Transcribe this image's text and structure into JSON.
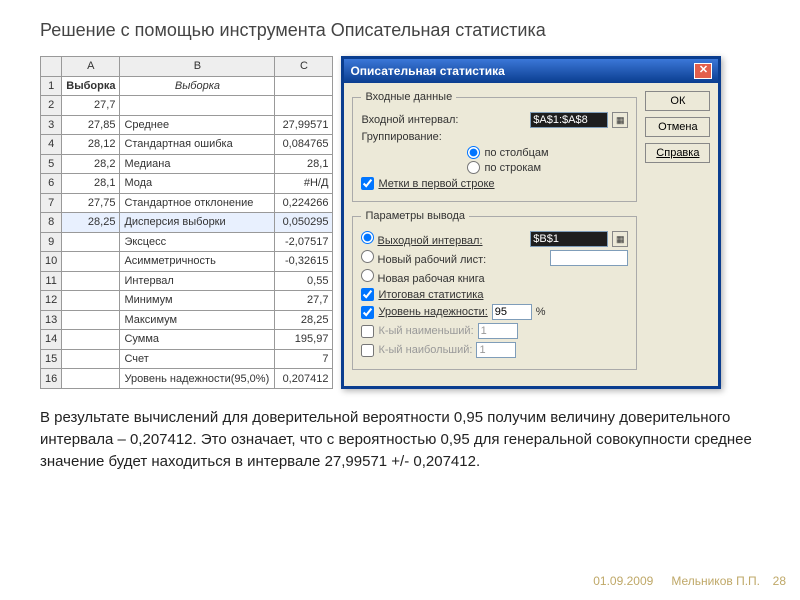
{
  "title": "Решение с помощью инструмента Описательная статистика",
  "spreadsheet": {
    "cols": [
      "A",
      "B",
      "C"
    ],
    "header_row": {
      "num": "1",
      "a": "Выборка",
      "b": "Выборка",
      "c": ""
    },
    "rows": [
      {
        "num": "2",
        "a": "27,7",
        "b": "",
        "c": ""
      },
      {
        "num": "3",
        "a": "27,85",
        "b": "Среднее",
        "c": "27,99571"
      },
      {
        "num": "4",
        "a": "28,12",
        "b": "Стандартная ошибка",
        "c": "0,084765"
      },
      {
        "num": "5",
        "a": "28,2",
        "b": "Медиана",
        "c": "28,1"
      },
      {
        "num": "6",
        "a": "28,1",
        "b": "Мода",
        "c": "#Н/Д"
      },
      {
        "num": "7",
        "a": "27,75",
        "b": "Стандартное отклонение",
        "c": "0,224266"
      },
      {
        "num": "8",
        "a": "28,25",
        "b": "Дисперсия выборки",
        "c": "0,050295"
      },
      {
        "num": "9",
        "a": "",
        "b": "Эксцесс",
        "c": "-2,07517"
      },
      {
        "num": "10",
        "a": "",
        "b": "Асимметричность",
        "c": "-0,32615"
      },
      {
        "num": "11",
        "a": "",
        "b": "Интервал",
        "c": "0,55"
      },
      {
        "num": "12",
        "a": "",
        "b": "Минимум",
        "c": "27,7"
      },
      {
        "num": "13",
        "a": "",
        "b": "Максимум",
        "c": "28,25"
      },
      {
        "num": "14",
        "a": "",
        "b": "Сумма",
        "c": "195,97"
      },
      {
        "num": "15",
        "a": "",
        "b": "Счет",
        "c": "7"
      },
      {
        "num": "16",
        "a": "",
        "b": "Уровень надежности(95,0%)",
        "c": "0,207412"
      }
    ]
  },
  "dialog": {
    "title": "Описательная статистика",
    "buttons": {
      "ok": "ОК",
      "cancel": "Отмена",
      "help": "Справка"
    },
    "group1": {
      "legend": "Входные данные",
      "input_label": "Входной интервал:",
      "input_value": "$A$1:$A$8",
      "group_label": "Группирование:",
      "by_cols": "по столбцам",
      "by_rows": "по строкам",
      "first_row": "Метки в первой строке"
    },
    "group2": {
      "legend": "Параметры вывода",
      "out_interval": "Выходной интервал:",
      "out_value": "$B$1",
      "new_sheet": "Новый рабочий лист:",
      "new_book": "Новая рабочая книга",
      "summary": "Итоговая статистика",
      "confidence": "Уровень надежности:",
      "confidence_val": "95",
      "percent": "%",
      "kth_small": "К-ый наименьший:",
      "kth_large": "К-ый наибольший:",
      "one": "1"
    }
  },
  "body_text": "В результате вычислений для доверительной вероятности 0,95 получим величину доверительного интервала – 0,207412. Это означает, что с вероятностью 0,95 для генеральной совокупности среднее значение будет находиться в интервале 27,99571 +/- 0,207412.",
  "footer": {
    "date": "01.09.2009",
    "author": "Мельников П.П.",
    "page": "28"
  }
}
